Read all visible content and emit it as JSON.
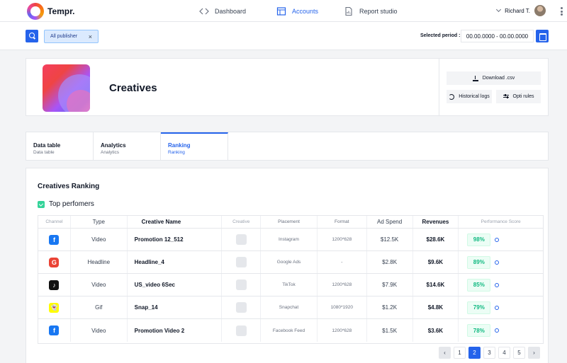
{
  "nav": {
    "brand": "Tempr.",
    "items": [
      {
        "label": "Dashboard",
        "icon": "code-icon"
      },
      {
        "label": "Accounts",
        "icon": "table-icon",
        "active": true
      },
      {
        "label": "Report studio",
        "icon": "document-chart-icon"
      }
    ],
    "user_name": "Richard T."
  },
  "filter": {
    "chip_label": "All publisher",
    "chip_close": "×",
    "period_label": "Selected period :",
    "period_value": "00.00.0000 - 00.00.0000"
  },
  "header": {
    "title": "Creatives",
    "download_label": "Download .csv",
    "logs_label": "Historical logs",
    "rules_label": "Opti rules"
  },
  "tabs": [
    {
      "title": "Data table",
      "sub": "Data table"
    },
    {
      "title": "Analytics",
      "sub": "Analytics"
    },
    {
      "title": "Ranking",
      "sub": "Ranking",
      "active": true
    }
  ],
  "ranking": {
    "title": "Creatives Ranking",
    "section": "Top perfomers",
    "columns": [
      "Channel",
      "Type",
      "Creative Name",
      "Creative",
      "Placement",
      "Format",
      "Ad Spend",
      "Revenues",
      "Performance Score"
    ],
    "rows": [
      {
        "channel": "facebook",
        "glyph": "f",
        "type": "Video",
        "name": "Promotion 12_512",
        "placement": "Instagram",
        "format": "1200*628",
        "spend": "$12.5K",
        "revenue": "$28.6K",
        "score": "98%"
      },
      {
        "channel": "google",
        "glyph": "G",
        "type": "Headline",
        "name": "Headline_4",
        "placement": "Google Ads",
        "format": "-",
        "spend": "$2.8K",
        "revenue": "$9.6K",
        "score": "89%"
      },
      {
        "channel": "tiktok",
        "glyph": "♪",
        "type": "Video",
        "name": "US_video 6Sec",
        "placement": "TikTok",
        "format": "1200*628",
        "spend": "$7.9K",
        "revenue": "$14.6K",
        "score": "85%"
      },
      {
        "channel": "snapchat",
        "glyph": "👻",
        "type": "Gif",
        "name": "Snap_14",
        "placement": "Snapchat",
        "format": "1080*1920",
        "spend": "$1.2K",
        "revenue": "$4.8K",
        "score": "79%"
      },
      {
        "channel": "facebook",
        "glyph": "f",
        "type": "Video",
        "name": "Promotion Video 2",
        "placement": "Facebook Feed",
        "format": "1200*628",
        "spend": "$1.5K",
        "revenue": "$3.6K",
        "score": "78%"
      }
    ]
  },
  "pagination": {
    "prev": "‹",
    "pages": [
      "1",
      "2",
      "3",
      "4",
      "5"
    ],
    "active_page": "2",
    "next": "›"
  }
}
